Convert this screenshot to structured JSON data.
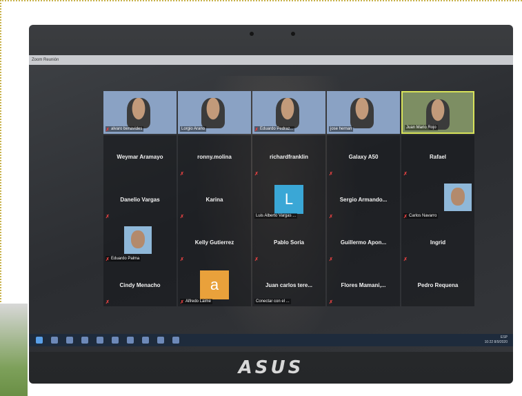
{
  "window": {
    "title": "Zoom Reunión"
  },
  "brand": "ASUS",
  "rows": [
    {
      "tiles": [
        {
          "kind": "video",
          "name": "alvaro benavides",
          "muted": true
        },
        {
          "kind": "video",
          "name": "Lorgio Arano",
          "muted": false
        },
        {
          "kind": "video",
          "name": "Eduardo Pedraz...",
          "muted": true
        },
        {
          "kind": "video",
          "name": "jose hernan",
          "muted": false
        },
        {
          "kind": "video",
          "name": "Juan Mario Rojo",
          "muted": false,
          "active": true
        }
      ]
    },
    {
      "tiles": [
        {
          "kind": "name",
          "name": "Weymar Aramayo",
          "muted": false
        },
        {
          "kind": "name",
          "name": "ronny.molina",
          "muted": true
        },
        {
          "kind": "name",
          "name": "richardfranklin",
          "muted": true
        },
        {
          "kind": "name",
          "name": "Galaxy A50",
          "muted": true
        },
        {
          "kind": "name",
          "name": "Rafael",
          "muted": true
        }
      ]
    },
    {
      "tiles": [
        {
          "kind": "name",
          "name": "Danelio Vargas",
          "muted": true
        },
        {
          "kind": "name",
          "name": "Karina",
          "muted": true
        },
        {
          "kind": "letter",
          "letter": "L",
          "color": "#3aa7d6",
          "name": "Luis Alberto Vargas ...",
          "muted": false
        },
        {
          "kind": "name",
          "name": "Sergio  Armando...",
          "muted": true
        },
        {
          "kind": "photo",
          "name": "Carlos Navarro",
          "muted": true
        }
      ]
    },
    {
      "tiles": [
        {
          "kind": "photo",
          "name": "Eduardo Palma",
          "muted": true
        },
        {
          "kind": "name",
          "name": "Kelly Gutierrez",
          "muted": true
        },
        {
          "kind": "name",
          "name": "Pablo Soria",
          "muted": true
        },
        {
          "kind": "name",
          "name": "Guillermo  Apon...",
          "muted": true
        },
        {
          "kind": "name",
          "name": "Ingrid",
          "muted": true
        }
      ]
    },
    {
      "tiles": [
        {
          "kind": "name",
          "name": "Cindy Menacho",
          "muted": true
        },
        {
          "kind": "letter",
          "letter": "a",
          "color": "#e9a13b",
          "name": "Alfredo Laime",
          "muted": true
        },
        {
          "kind": "name",
          "name": "Juan carlos tere...",
          "sub": "Conectar con el ...",
          "muted": false
        },
        {
          "kind": "name",
          "name": "Flores  Mamani,...",
          "muted": true
        },
        {
          "kind": "name",
          "name": "Pedro Requena",
          "muted": false
        }
      ]
    }
  ],
  "tray": {
    "lang": "ESP",
    "time": "10:22",
    "date": "8/9/2020"
  },
  "icons": {
    "mic_off": "mic-off-icon",
    "windows": "windows-start-icon"
  },
  "colors": {
    "active_border": "#d8e35a",
    "mic_off": "#e04040"
  }
}
